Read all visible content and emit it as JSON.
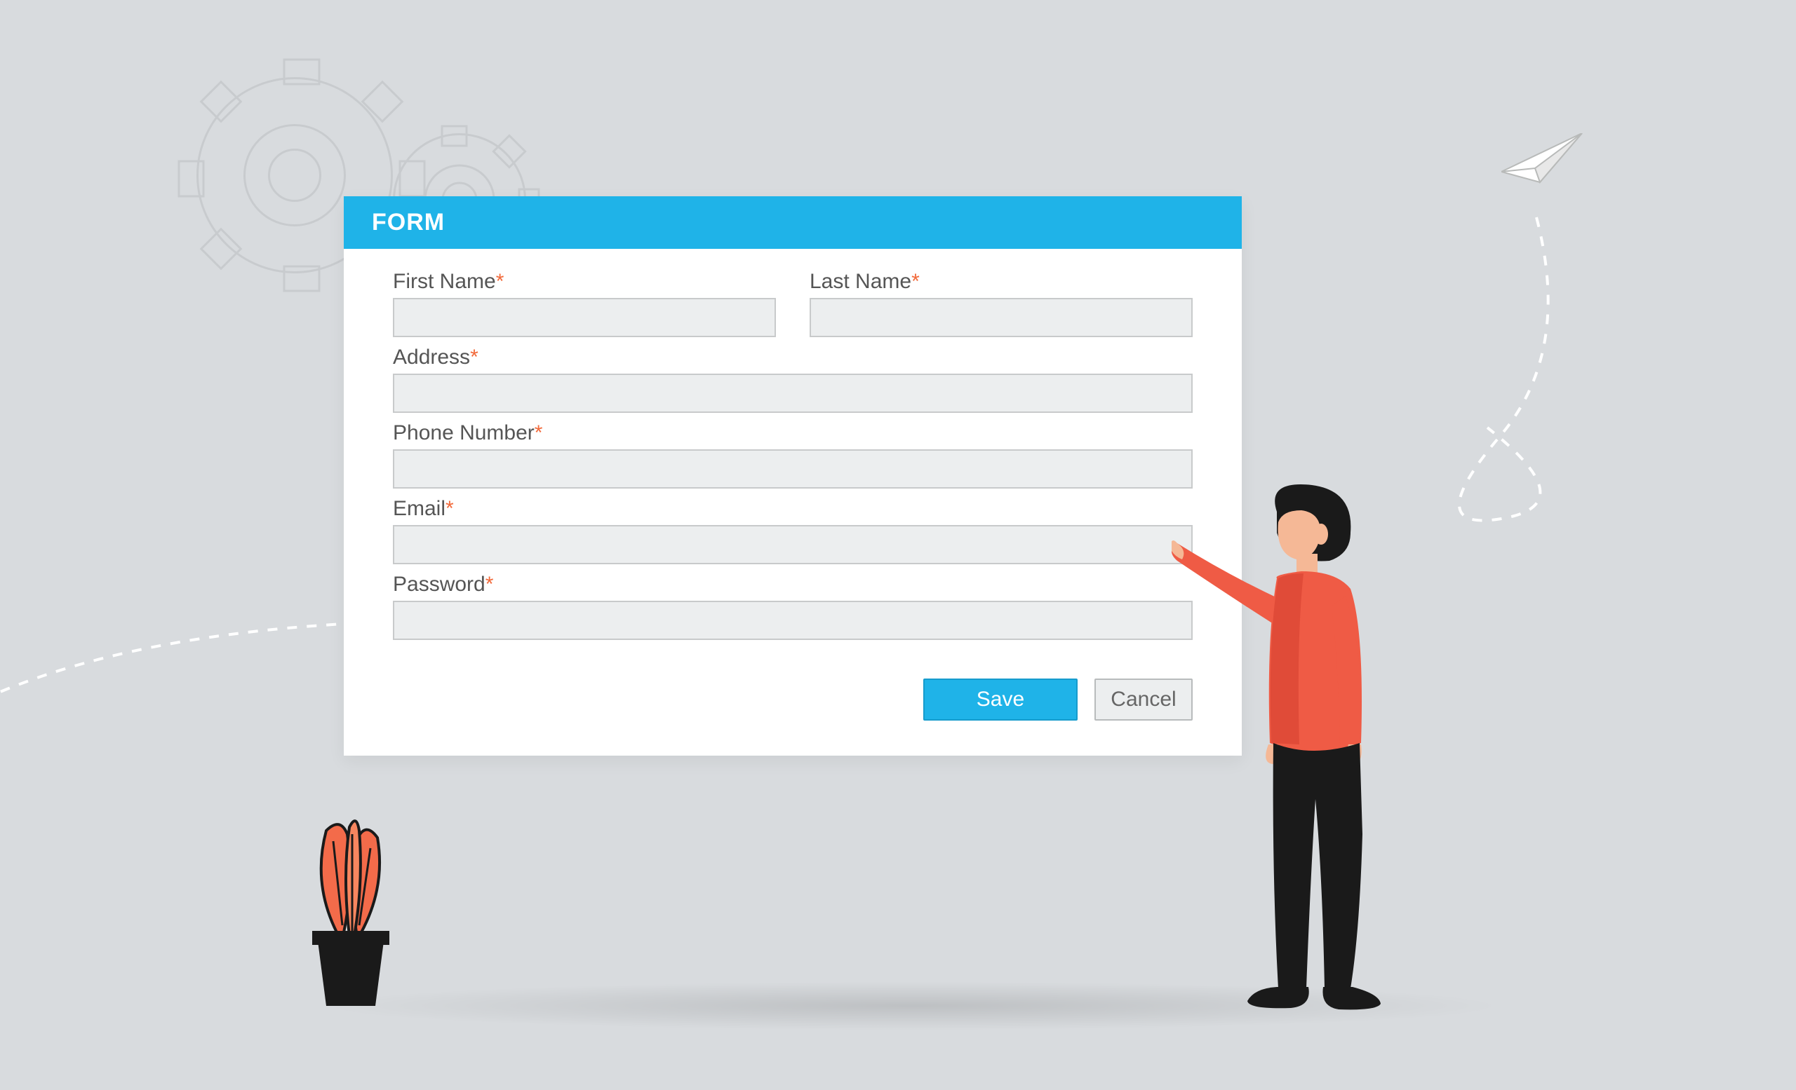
{
  "form": {
    "title": "FORM",
    "fields": {
      "first_name": {
        "label": "First Name",
        "required": true,
        "value": ""
      },
      "last_name": {
        "label": "Last Name",
        "required": true,
        "value": ""
      },
      "address": {
        "label": "Address",
        "required": true,
        "value": ""
      },
      "phone": {
        "label": "Phone Number",
        "required": true,
        "value": ""
      },
      "email": {
        "label": "Email",
        "required": true,
        "value": ""
      },
      "password": {
        "label": "Password",
        "required": true,
        "value": ""
      }
    },
    "actions": {
      "save_label": "Save",
      "cancel_label": "Cancel"
    },
    "required_marker": "*"
  },
  "colors": {
    "accent": "#1fb3e8",
    "required": "#f26a3b",
    "background": "#d8dbde"
  }
}
